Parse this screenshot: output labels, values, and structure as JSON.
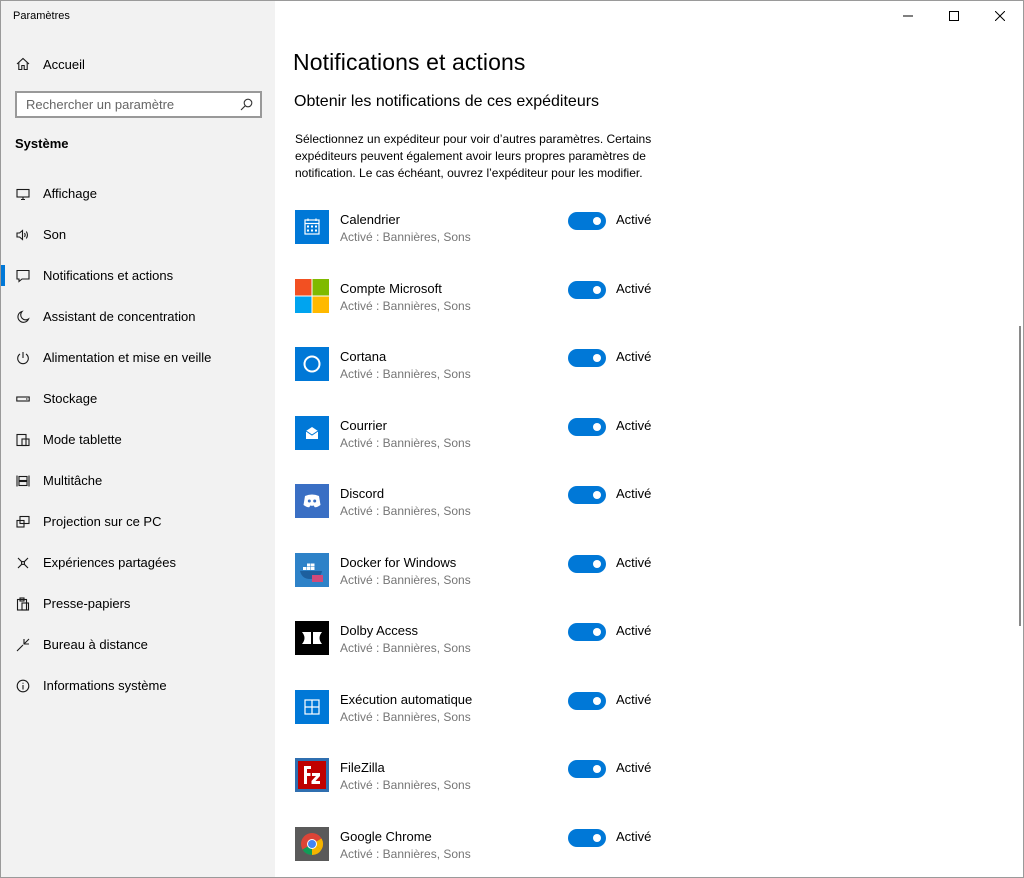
{
  "window": {
    "title": "Paramètres"
  },
  "sidebar": {
    "home": {
      "label": "Accueil",
      "icon": "home-icon"
    },
    "search": {
      "placeholder": "Rechercher un paramètre",
      "icon": "search-icon"
    },
    "section": "Système",
    "items": [
      {
        "label": "Affichage",
        "icon": "monitor-icon",
        "active": false
      },
      {
        "label": "Son",
        "icon": "speaker-icon",
        "active": false
      },
      {
        "label": "Notifications et actions",
        "icon": "notification-icon",
        "active": true
      },
      {
        "label": "Assistant de concentration",
        "icon": "moon-icon",
        "active": false
      },
      {
        "label": "Alimentation et mise en veille",
        "icon": "power-icon",
        "active": false
      },
      {
        "label": "Stockage",
        "icon": "storage-icon",
        "active": false
      },
      {
        "label": "Mode tablette",
        "icon": "tablet-icon",
        "active": false
      },
      {
        "label": "Multitâche",
        "icon": "multitask-icon",
        "active": false
      },
      {
        "label": "Projection sur ce PC",
        "icon": "projection-icon",
        "active": false
      },
      {
        "label": "Expériences partagées",
        "icon": "shared-icon",
        "active": false
      },
      {
        "label": "Presse-papiers",
        "icon": "clipboard-icon",
        "active": false
      },
      {
        "label": "Bureau à distance",
        "icon": "remote-desktop-icon",
        "active": false
      },
      {
        "label": "Informations système",
        "icon": "info-icon",
        "active": false
      }
    ]
  },
  "main": {
    "title": "Notifications et actions",
    "subtitle": "Obtenir les notifications de ces expéditeurs",
    "description": "Sélectionnez un expéditeur pour voir d’autres paramètres. Certains expéditeurs peuvent également avoir leurs propres paramètres de notification. Le cas échéant, ouvrez l’expéditeur pour les modifier.",
    "senders": [
      {
        "name": "Calendrier",
        "status": "Activé : Bannières, Sons",
        "toggle": "Activé",
        "icon": "calendar-icon"
      },
      {
        "name": "Compte Microsoft",
        "status": "Activé : Bannières, Sons",
        "toggle": "Activé",
        "icon": "microsoft-logo-icon"
      },
      {
        "name": "Cortana",
        "status": "Activé : Bannières, Sons",
        "toggle": "Activé",
        "icon": "cortana-icon"
      },
      {
        "name": "Courrier",
        "status": "Activé : Bannières, Sons",
        "toggle": "Activé",
        "icon": "mail-icon"
      },
      {
        "name": "Discord",
        "status": "Activé : Bannières, Sons",
        "toggle": "Activé",
        "icon": "discord-icon"
      },
      {
        "name": "Docker for Windows",
        "status": "Activé : Bannières, Sons",
        "toggle": "Activé",
        "icon": "docker-icon"
      },
      {
        "name": "Dolby Access",
        "status": "Activé : Bannières, Sons",
        "toggle": "Activé",
        "icon": "dolby-icon"
      },
      {
        "name": "Exécution automatique",
        "status": "Activé : Bannières, Sons",
        "toggle": "Activé",
        "icon": "autoplay-icon"
      },
      {
        "name": "FileZilla",
        "status": "Activé : Bannières, Sons",
        "toggle": "Activé",
        "icon": "filezilla-icon"
      },
      {
        "name": "Google Chrome",
        "status": "Activé : Bannières, Sons",
        "toggle": "Activé",
        "icon": "chrome-icon"
      }
    ]
  },
  "colors": {
    "accent": "#0078d7",
    "sidebar_bg": "#f2f2f2",
    "secondary_text": "#767676"
  }
}
